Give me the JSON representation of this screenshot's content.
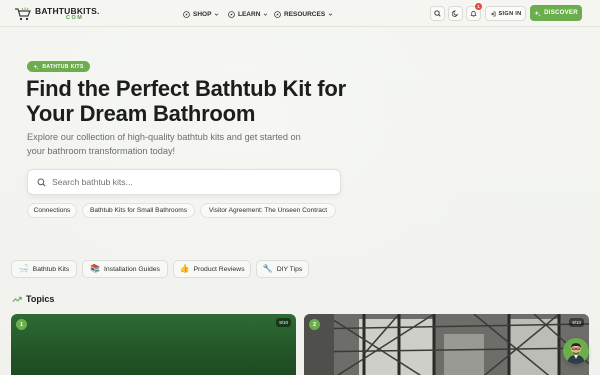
{
  "brand": {
    "name": "BATHTUBKITS.",
    "suffix": "COM",
    "accent": "#6cae4e"
  },
  "nav": [
    {
      "label": "SHOP",
      "icon": "compass-icon"
    },
    {
      "label": "LEARN",
      "icon": "compass-icon"
    },
    {
      "label": "RESOURCES",
      "icon": "compass-icon"
    }
  ],
  "header": {
    "notification_count": "1",
    "sign_in_label": "SIGN IN",
    "discover_label": "DISCOVER"
  },
  "hero": {
    "badge": "BATHTUB KITS",
    "title": "Find the Perfect Bathtub Kit for Your Dream Bathroom",
    "subtitle": "Explore our collection of high-quality bathtub kits and get started on your bathroom transformation today!",
    "search_placeholder": "Search bathtub kits...",
    "chips": [
      "Connections",
      "Bathtub Kits for Small Bathrooms",
      "Visitor Agreement: The Unseen Contract"
    ]
  },
  "categories": [
    {
      "label": "Bathtub Kits",
      "icon": "bathtub-icon"
    },
    {
      "label": "Installation Guides",
      "icon": "book-icon"
    },
    {
      "label": "Product Reviews",
      "icon": "thumbs-up-icon"
    },
    {
      "label": "DIY Tips",
      "icon": "wrench-icon"
    }
  ],
  "topics": {
    "heading": "Topics",
    "cards": [
      {
        "number": "1",
        "score": "9/10"
      },
      {
        "number": "2",
        "score": "9/10"
      }
    ]
  }
}
